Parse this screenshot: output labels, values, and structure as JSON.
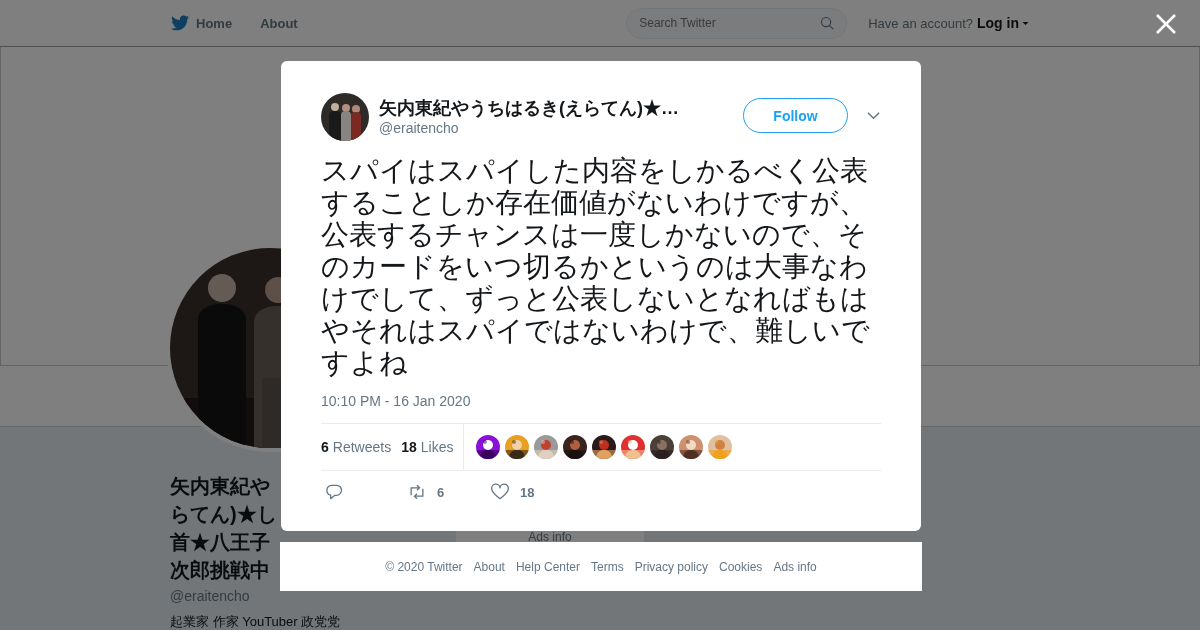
{
  "nav": {
    "links": [
      {
        "kind": "home",
        "label": "Home"
      },
      {
        "kind": "plain",
        "label": "About"
      }
    ],
    "search": {
      "placeholder": "Search Twitter"
    },
    "account_prompt": "Have an account?",
    "login": "Log in"
  },
  "profile": {
    "name_lines": [
      "矢内東紀や",
      "らてん)★し",
      "首★八王子",
      "次郎挑戦中"
    ],
    "handle": "@eraitencho",
    "bio": "起業家 作家 YouTuber 政党党",
    "ads_info": "Ads info"
  },
  "tweet": {
    "author": {
      "name": "矢内東紀やうちはるき(えらてん)★…",
      "handle": "@eraitencho"
    },
    "follow": "Follow",
    "text": "スパイはスパイした内容をしかるべく公表することしか存在価値がないわけですが、公表するチャンスは一度しかないので、そのカードをいつ切るかというのは大事なわけでして、ずっと公表しないとなればもはやそれはスパイではないわけで、難しいですよね",
    "timestamp": "10:10 PM - 16 Jan 2020",
    "stats": [
      {
        "count": "6",
        "label": "Retweets"
      },
      {
        "count": "18",
        "label": "Likes"
      }
    ],
    "actions": [
      {
        "kind": "reply"
      },
      {
        "kind": "retweet",
        "count": "6"
      },
      {
        "kind": "like",
        "count": "18"
      }
    ]
  },
  "footer": {
    "links": [
      "© 2020 Twitter",
      "About",
      "Help Center",
      "Terms",
      "Privacy policy",
      "Cookies",
      "Ads info"
    ]
  }
}
